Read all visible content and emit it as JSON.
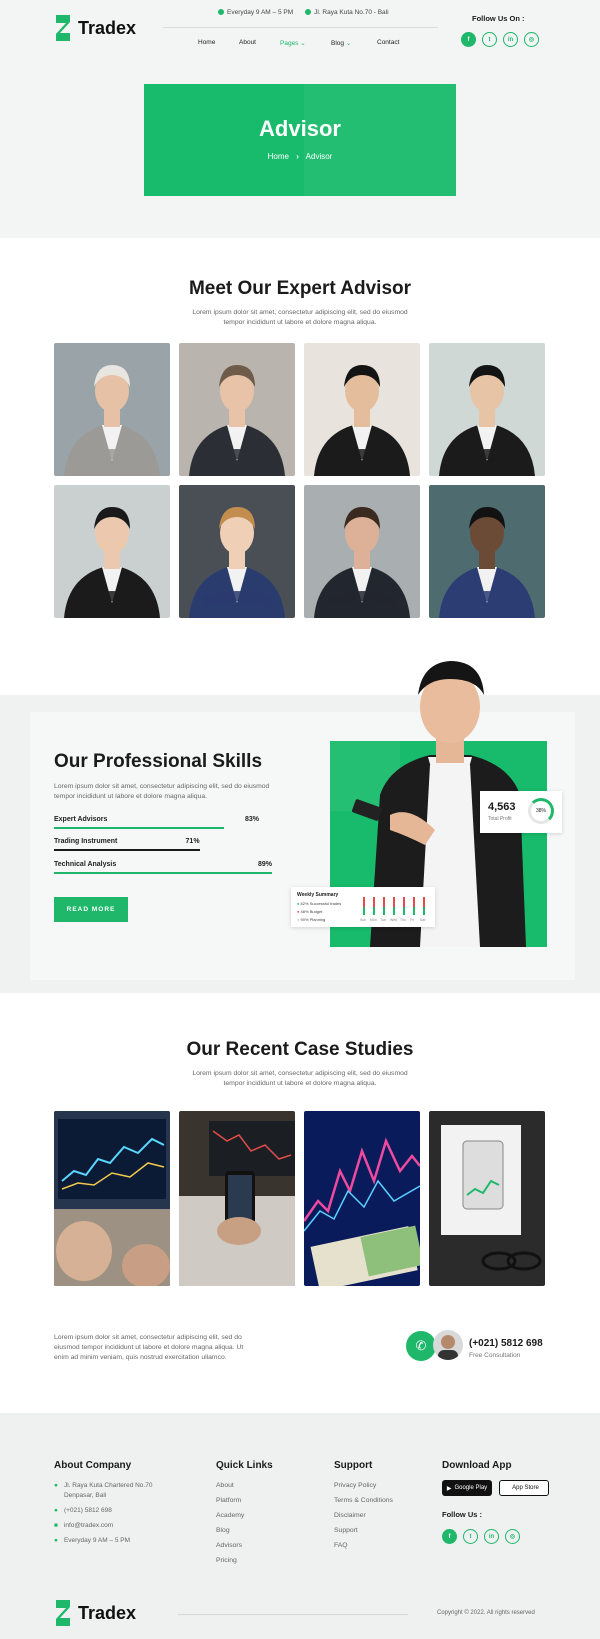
{
  "brand": {
    "name": "Tradex"
  },
  "topbar": {
    "hours": "Everyday 9 AM – 5 PM",
    "address": "Jl. Raya Kuta No.70 - Bali"
  },
  "nav": {
    "items": [
      {
        "label": "Home"
      },
      {
        "label": "About"
      },
      {
        "label": "Pages",
        "active": true,
        "dropdown": true
      },
      {
        "label": "Blog",
        "dropdown": true
      },
      {
        "label": "Contact"
      }
    ]
  },
  "follow": {
    "title": "Follow Us On :",
    "icons": [
      "facebook-icon",
      "twitter-icon",
      "linkedin-icon",
      "instagram-icon"
    ]
  },
  "hero": {
    "title": "Advisor",
    "crumb_home": "Home",
    "crumb_sep": "›",
    "crumb_current": "Advisor"
  },
  "advisors": {
    "title": "Meet Our Expert Advisor",
    "subtitle1": "Lorem ipsum dolor sit amet, consectetur adipiscing elit, sed do eiusmod",
    "subtitle2": "tempor incididunt ut labore et dolore magna aliqua."
  },
  "skills": {
    "title": "Our Professional Skills",
    "text1": "Lorem ipsum dolor sit amet, consectetur adipiscing elit, sed do eiusmod",
    "text2": "tempor incididunt ut labore et dolore magna aliqua.",
    "items": [
      {
        "label": "Expert Advisors",
        "value": "83%",
        "pct": 0.83
      },
      {
        "label": "Trading Instrument",
        "value": "71%",
        "pct": 0.71
      },
      {
        "label": "Technical Analysis",
        "value": "89%",
        "pct": 0.89
      }
    ],
    "button": "READ MORE",
    "stat_value": "4,563",
    "stat_label": "Total Profit",
    "stat_pct": "38%",
    "summary_title": "Weekly Summary",
    "summary_rows": [
      {
        "pct": "82%",
        "label": "Successful trades"
      },
      {
        "pct": "48%",
        "label": "Budget"
      },
      {
        "pct": "90%",
        "label": "Planning"
      }
    ],
    "summary_days": [
      "Sun",
      "Mon",
      "Tue",
      "Wed",
      "Thu",
      "Fri",
      "Sat"
    ]
  },
  "cases": {
    "title": "Our Recent Case Studies",
    "subtitle1": "Lorem ipsum dolor sit amet, consectetur adipiscing elit, sed do eiusmod",
    "subtitle2": "tempor incididunt ut labore et dolore magna aliqua."
  },
  "contact": {
    "text1": "Lorem ipsum dolor sit amet, consectetur adipiscing elit, sed do",
    "text2": "eiusmod tempor incididunt ut labore et dolore magna aliqua. Ut",
    "text3": "enim ad minim veniam, quis nostrud exercitation ullamco.",
    "phone": "(+021) 5812 698",
    "phone_label": "Free Consultation"
  },
  "footer": {
    "about": {
      "title": "About Company",
      "address1": "Jl. Raya Kuta Chartered No.70",
      "address2": "Denpasar, Bali",
      "phone": "(+021) 5812 698",
      "email": "info@tradex.com",
      "hours": "Everyday 9 AM – 5 PM"
    },
    "quick": {
      "title": "Quick Links",
      "links": [
        "About",
        "Platform",
        "Academy",
        "Blog",
        "Advisors",
        "Pricing"
      ]
    },
    "support": {
      "title": "Support",
      "links": [
        "Privacy Policy",
        "Terms & Conditions",
        "Disclaimer",
        "Support",
        "FAQ"
      ]
    },
    "app": {
      "title": "Download App",
      "google": "Google Play",
      "apple": "App Store",
      "follow": "Follow Us :"
    },
    "copyright": "Copyright © 2022. All rights reserved"
  }
}
